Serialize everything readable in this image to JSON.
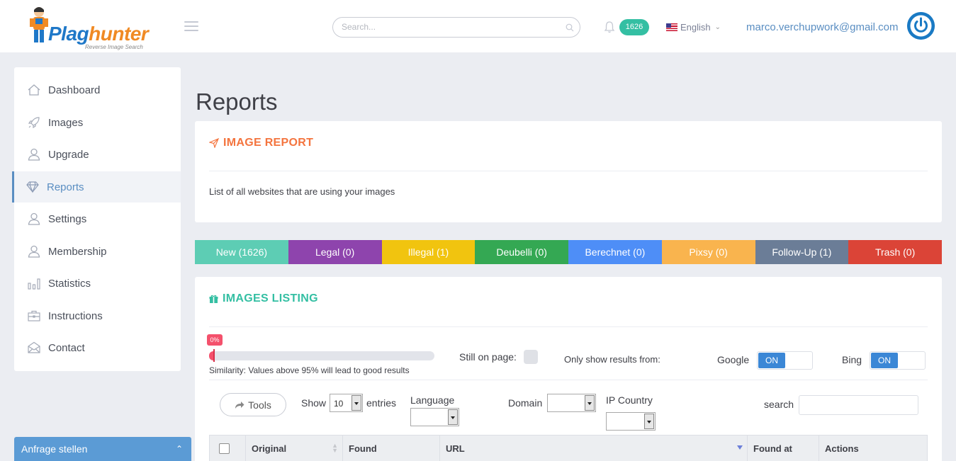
{
  "header": {
    "logo_text_a": "Plag",
    "logo_text_b": "hunter",
    "logo_sub": "Reverse Image Search",
    "search_placeholder": "Search...",
    "notifications": "1626",
    "language": "English",
    "email": "marco.verchupwork@gmail.com"
  },
  "sidebar": {
    "items": [
      {
        "label": "Dashboard",
        "icon": "home-icon"
      },
      {
        "label": "Images",
        "icon": "rocket-icon"
      },
      {
        "label": "Upgrade",
        "icon": "user-icon"
      },
      {
        "label": "Reports",
        "icon": "diamond-icon"
      },
      {
        "label": "Settings",
        "icon": "user-icon"
      },
      {
        "label": "Membership",
        "icon": "user-icon"
      },
      {
        "label": "Statistics",
        "icon": "bar-chart-icon"
      },
      {
        "label": "Instructions",
        "icon": "briefcase-icon"
      },
      {
        "label": "Contact",
        "icon": "envelope-icon"
      }
    ],
    "active_index": 3
  },
  "anfrage": {
    "label": "Anfrage stellen"
  },
  "page": {
    "title": "Reports"
  },
  "report_card": {
    "title": "IMAGE REPORT",
    "description": "List of all websites that are using your images"
  },
  "status_tabs": [
    {
      "label": "New (1626)",
      "color": "#5dcdb4"
    },
    {
      "label": "Legal (0)",
      "color": "#8e44ad"
    },
    {
      "label": "Illegal (1)",
      "color": "#f1c40f"
    },
    {
      "label": "Deubelli (0)",
      "color": "#34a853"
    },
    {
      "label": "Berechnet (0)",
      "color": "#4e8ef7"
    },
    {
      "label": "Pixsy (0)",
      "color": "#f9b44e"
    },
    {
      "label": "Follow-Up (1)",
      "color": "#6b7d97"
    },
    {
      "label": "Trash (0)",
      "color": "#db4437"
    }
  ],
  "listing": {
    "title": "IMAGES LISTING",
    "similarity_pct": "0%",
    "similarity_value": 0.02,
    "similarity_hint": "Similarity: Values above 95% will lead to good results",
    "still_on_page": "Still on page:",
    "only_show": "Only show results from:",
    "google_label": "Google",
    "google_toggle": "ON",
    "bing_label": "Bing",
    "bing_toggle": "ON",
    "tools": "Tools",
    "show": "Show",
    "show_value": "10",
    "entries": "entries",
    "language": "Language",
    "domain": "Domain",
    "ip_country": "IP Country",
    "search": "search",
    "columns": [
      "Original",
      "Found",
      "URL",
      "Found at",
      "Actions"
    ]
  }
}
